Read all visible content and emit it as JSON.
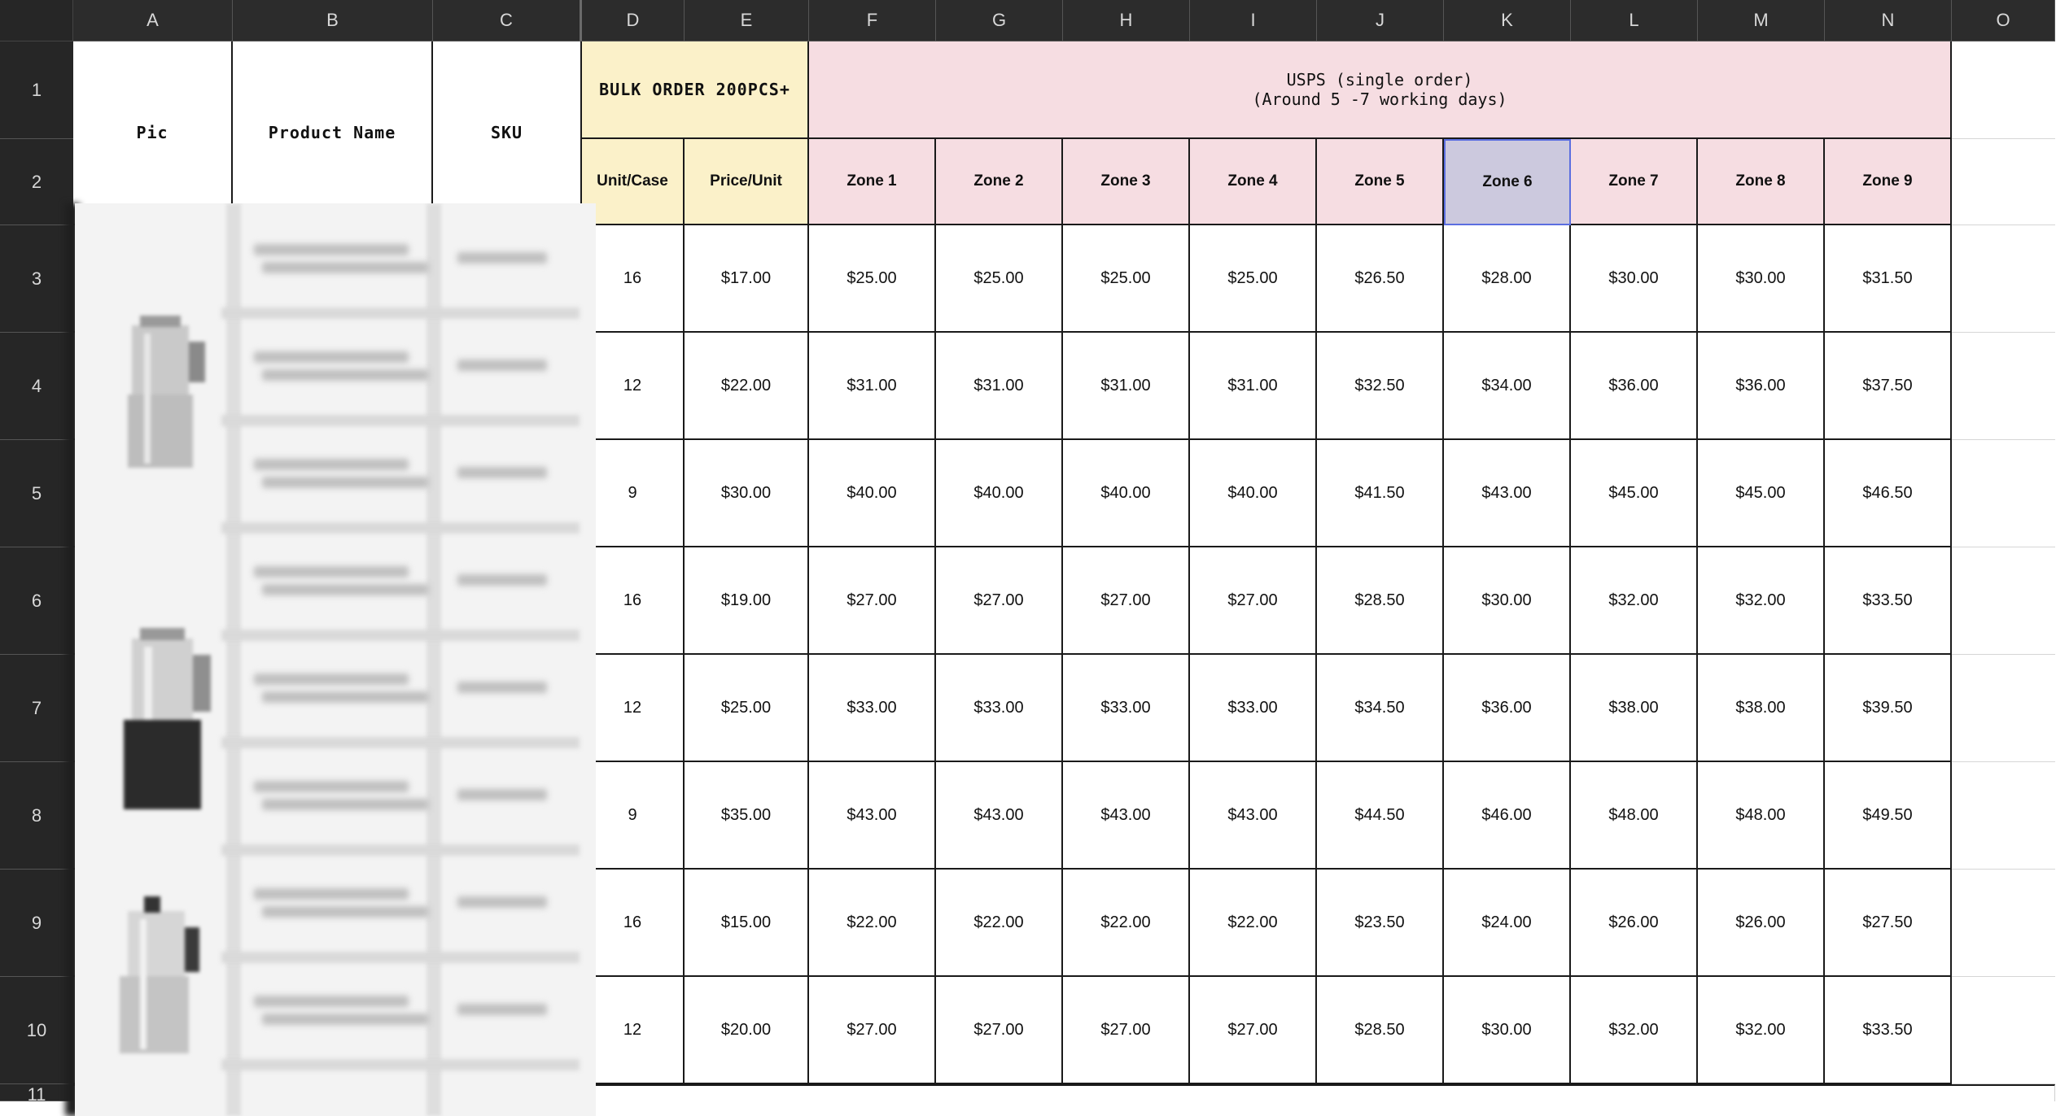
{
  "columns": [
    "A",
    "B",
    "C",
    "D",
    "E",
    "F",
    "G",
    "H",
    "I",
    "J",
    "K",
    "L",
    "M",
    "N",
    "O"
  ],
  "rows": [
    "1",
    "2",
    "3",
    "4",
    "5",
    "6",
    "7",
    "8",
    "9",
    "10",
    "11"
  ],
  "header": {
    "pic": "Pic",
    "product_name": "Product Name",
    "sku": "SKU",
    "bulk": "BULK ORDER 200PCS+",
    "usps_line1": "USPS (single order)",
    "usps_line2": "(Around 5 -7 working days)",
    "unit_case": "Unit/Case",
    "price_unit": "Price/Unit",
    "zones": [
      "Zone 1",
      "Zone 2",
      "Zone 3",
      "Zone 4",
      "Zone 5",
      "Zone 6",
      "Zone 7",
      "Zone 8",
      "Zone 9"
    ]
  },
  "colors": {
    "bulk_fill": "#fbf1c9",
    "usps_fill": "#f6dde2",
    "selected_fill": "#ccc9de",
    "selected_border": "#5b6ee0",
    "header_bg": "#2c2c2c"
  },
  "selected_cell": "K2",
  "table": [
    {
      "unit_case": "16",
      "price": "$17.00",
      "zones": [
        "$25.00",
        "$25.00",
        "$25.00",
        "$25.00",
        "$26.50",
        "$28.00",
        "$30.00",
        "$30.00",
        "$31.50"
      ]
    },
    {
      "unit_case": "12",
      "price": "$22.00",
      "zones": [
        "$31.00",
        "$31.00",
        "$31.00",
        "$31.00",
        "$32.50",
        "$34.00",
        "$36.00",
        "$36.00",
        "$37.50"
      ]
    },
    {
      "unit_case": "9",
      "price": "$30.00",
      "zones": [
        "$40.00",
        "$40.00",
        "$40.00",
        "$40.00",
        "$41.50",
        "$43.00",
        "$45.00",
        "$45.00",
        "$46.50"
      ]
    },
    {
      "unit_case": "16",
      "price": "$19.00",
      "zones": [
        "$27.00",
        "$27.00",
        "$27.00",
        "$27.00",
        "$28.50",
        "$30.00",
        "$32.00",
        "$32.00",
        "$33.50"
      ]
    },
    {
      "unit_case": "12",
      "price": "$25.00",
      "zones": [
        "$33.00",
        "$33.00",
        "$33.00",
        "$33.00",
        "$34.50",
        "$36.00",
        "$38.00",
        "$38.00",
        "$39.50"
      ]
    },
    {
      "unit_case": "9",
      "price": "$35.00",
      "zones": [
        "$43.00",
        "$43.00",
        "$43.00",
        "$43.00",
        "$44.50",
        "$46.00",
        "$48.00",
        "$48.00",
        "$49.50"
      ]
    },
    {
      "unit_case": "16",
      "price": "$15.00",
      "zones": [
        "$22.00",
        "$22.00",
        "$22.00",
        "$22.00",
        "$23.50",
        "$24.00",
        "$26.00",
        "$26.00",
        "$27.50"
      ]
    },
    {
      "unit_case": "12",
      "price": "$20.00",
      "zones": [
        "$27.00",
        "$27.00",
        "$27.00",
        "$27.00",
        "$28.50",
        "$30.00",
        "$32.00",
        "$32.00",
        "$33.50"
      ]
    }
  ]
}
